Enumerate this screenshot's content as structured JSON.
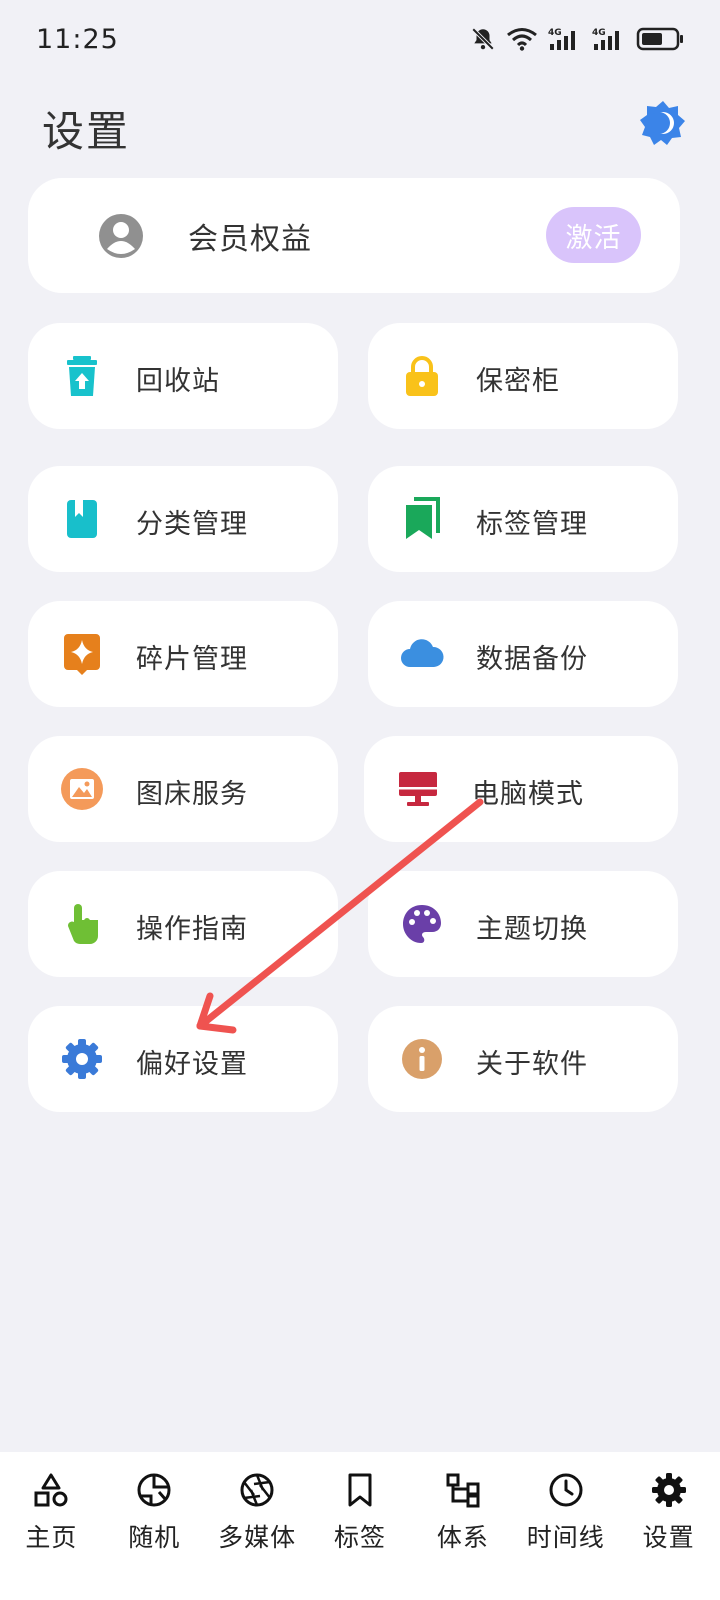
{
  "status": {
    "time": "11:25",
    "network_badges": [
      "4G",
      "4G"
    ]
  },
  "page": {
    "title": "设置"
  },
  "member": {
    "label": "会员权益",
    "activate_label": "激活"
  },
  "tiles": [
    {
      "label": "回收站",
      "icon": "recycle-bin-icon",
      "color": "#18c2cc"
    },
    {
      "label": "保密柜",
      "icon": "lock-icon",
      "color": "#f9c21a"
    },
    {
      "label": "分类管理",
      "icon": "notebook-icon",
      "color": "#18bfcb"
    },
    {
      "label": "标签管理",
      "icon": "bookmark-icon",
      "color": "#1aa85a"
    },
    {
      "label": "碎片管理",
      "icon": "sparkle-icon",
      "color": "#e6801c"
    },
    {
      "label": "数据备份",
      "icon": "cloud-icon",
      "color": "#3b8fe0"
    },
    {
      "label": "图床服务",
      "icon": "image-icon",
      "color": "#f49a5a"
    },
    {
      "label": "电脑模式",
      "icon": "desktop-icon",
      "color": "#c6283f"
    },
    {
      "label": "操作指南",
      "icon": "hand-pointer-icon",
      "color": "#6fbf35"
    },
    {
      "label": "主题切换",
      "icon": "palette-icon",
      "color": "#6a3fa8"
    },
    {
      "label": "偏好设置",
      "icon": "gear-icon",
      "color": "#3a7ad8"
    },
    {
      "label": "关于软件",
      "icon": "info-icon",
      "color": "#d9a06a"
    }
  ],
  "annotation": {
    "arrow_color": "#ef5350"
  },
  "nav": [
    {
      "label": "主页",
      "icon": "shapes-icon"
    },
    {
      "label": "随机",
      "icon": "random-icon"
    },
    {
      "label": "多媒体",
      "icon": "aperture-icon"
    },
    {
      "label": "标签",
      "icon": "bookmark-outline-icon"
    },
    {
      "label": "体系",
      "icon": "hierarchy-icon"
    },
    {
      "label": "时间线",
      "icon": "clock-icon"
    },
    {
      "label": "设置",
      "icon": "gear-icon"
    }
  ]
}
